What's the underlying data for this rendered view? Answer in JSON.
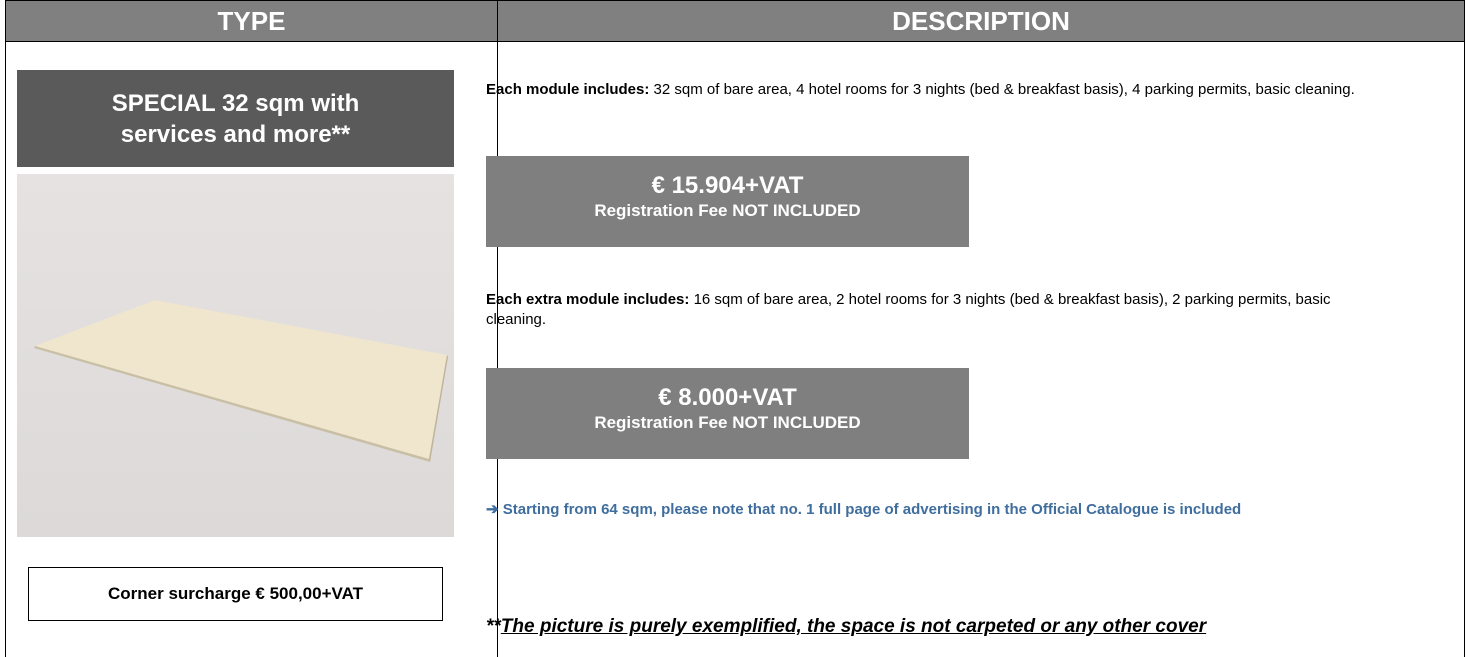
{
  "headers": {
    "type": "TYPE",
    "description": "DESCRIPTION"
  },
  "type_col": {
    "title_line1": "SPECIAL 32 sqm with",
    "title_line2": "services and more**",
    "corner_surcharge": "Corner surcharge € 500,00+VAT"
  },
  "description": {
    "module_label": "Each module includes:",
    "module_text": " 32 sqm of bare area, 4 hotel rooms for 3 nights (bed & breakfast basis), 4 parking permits, basic cleaning.",
    "module_price": "€ 15.904+VAT",
    "module_fee": "Registration Fee NOT INCLUDED",
    "extra_label": "Each extra module includes:",
    "extra_text": " 16 sqm of bare area, 2 hotel rooms for 3 nights (bed & breakfast basis), 2 parking permits, basic cleaning.",
    "extra_price": "€ 8.000+VAT",
    "extra_fee": "Registration Fee NOT INCLUDED",
    "note_arrow": "➔",
    "note_text": " Starting from 64 sqm, please note that no. 1 full page of advertising in the Official Catalogue is included",
    "disclaimer_prefix": "**",
    "disclaimer_text": "The picture is purely exemplified, the space is not carpeted or any other cover"
  },
  "colors": {
    "header_bg": "#808080",
    "title_bg": "#5a5a5a",
    "price_bg": "#7f7f7f",
    "note": "#3f6e9e"
  },
  "icons": {
    "note_arrow": "right-arrow-icon"
  }
}
